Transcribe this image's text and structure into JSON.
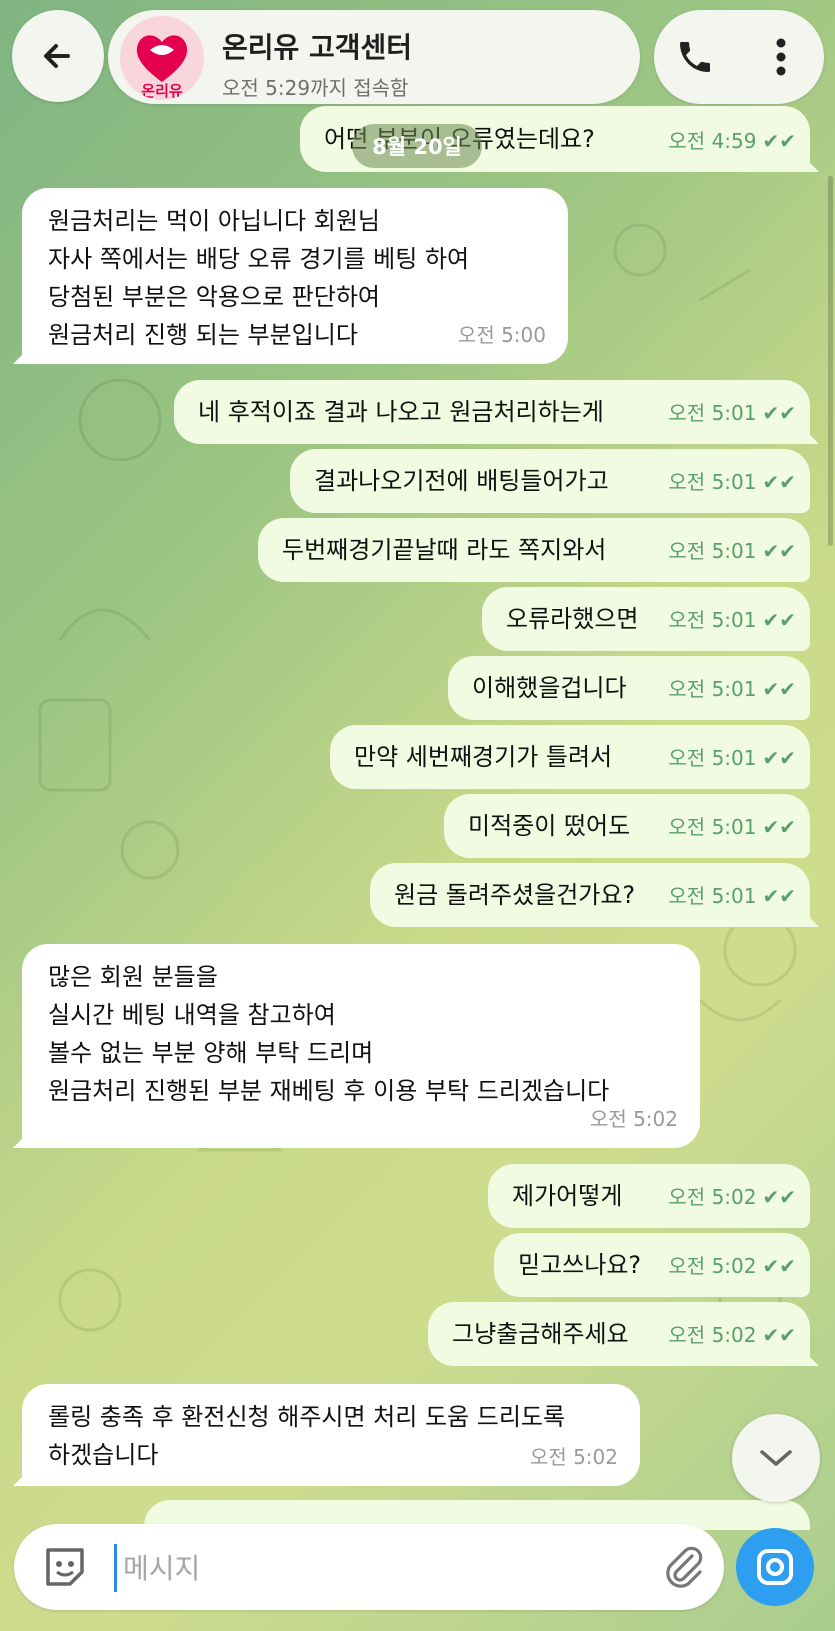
{
  "header": {
    "title": "온리유 고객센터",
    "status": "오전 5:29까지 접속함",
    "avatar_text": "온리유",
    "back_icon": "arrow-left-icon",
    "call_icon": "phone-icon",
    "more_icon": "more-vertical-icon"
  },
  "date_chip": "8월 20일",
  "messages": [
    {
      "dir": "out",
      "text": "어떤 부분이 오류였는데요?",
      "time": "오전 4:59"
    },
    {
      "dir": "in",
      "text": "원금처리는 먹이 아닙니다 회원님\n자사 쪽에서는 배당 오류 경기를 베팅 하여\n당첨된 부분은 악용으로 판단하여\n원금처리 진행 되는 부분입니다",
      "time": "오전 5:00"
    },
    {
      "dir": "out",
      "text": "네 후적이죠 결과 나오고 원금처리하는게",
      "time": "오전 5:01"
    },
    {
      "dir": "out",
      "text": "결과나오기전에 배팅들어가고",
      "time": "오전 5:01"
    },
    {
      "dir": "out",
      "text": "두번째경기끝날때 라도 쪽지와서",
      "time": "오전 5:01"
    },
    {
      "dir": "out",
      "text": "오류라했으면",
      "time": "오전 5:01"
    },
    {
      "dir": "out",
      "text": "이해했을겁니다",
      "time": "오전 5:01"
    },
    {
      "dir": "out",
      "text": "만약 세번째경기가 틀려서",
      "time": "오전 5:01"
    },
    {
      "dir": "out",
      "text": "미적중이 떴어도",
      "time": "오전 5:01"
    },
    {
      "dir": "out",
      "text": "원금 돌려주셨을건가요?",
      "time": "오전 5:01"
    },
    {
      "dir": "in",
      "text": "많은 회원 분들을\n실시간 베팅 내역을 참고하여\n볼수 없는 부분 양해 부탁 드리며\n원금처리 진행된 부분 재베팅 후 이용 부탁 드리겠습니다",
      "time": "오전 5:02"
    },
    {
      "dir": "out",
      "text": "제가어떻게",
      "time": "오전 5:02"
    },
    {
      "dir": "out",
      "text": "믿고쓰나요?",
      "time": "오전 5:02"
    },
    {
      "dir": "out",
      "text": "그냥출금해주세요",
      "time": "오전 5:02"
    },
    {
      "dir": "in",
      "text": "롤링 충족 후 환전신청 해주시면 처리 도움 드리도록\n하겠습니다",
      "time": "오전 5:02"
    }
  ],
  "input": {
    "placeholder": "메시지",
    "sticker_icon": "sticker-icon",
    "attach_icon": "paperclip-icon",
    "camera_icon": "camera-icon"
  },
  "scroll_down_icon": "chevron-down-icon",
  "colors": {
    "accent": "#2e9ff0",
    "outgoing_bubble": "#f0fbe2",
    "check": "#5aa06a"
  }
}
